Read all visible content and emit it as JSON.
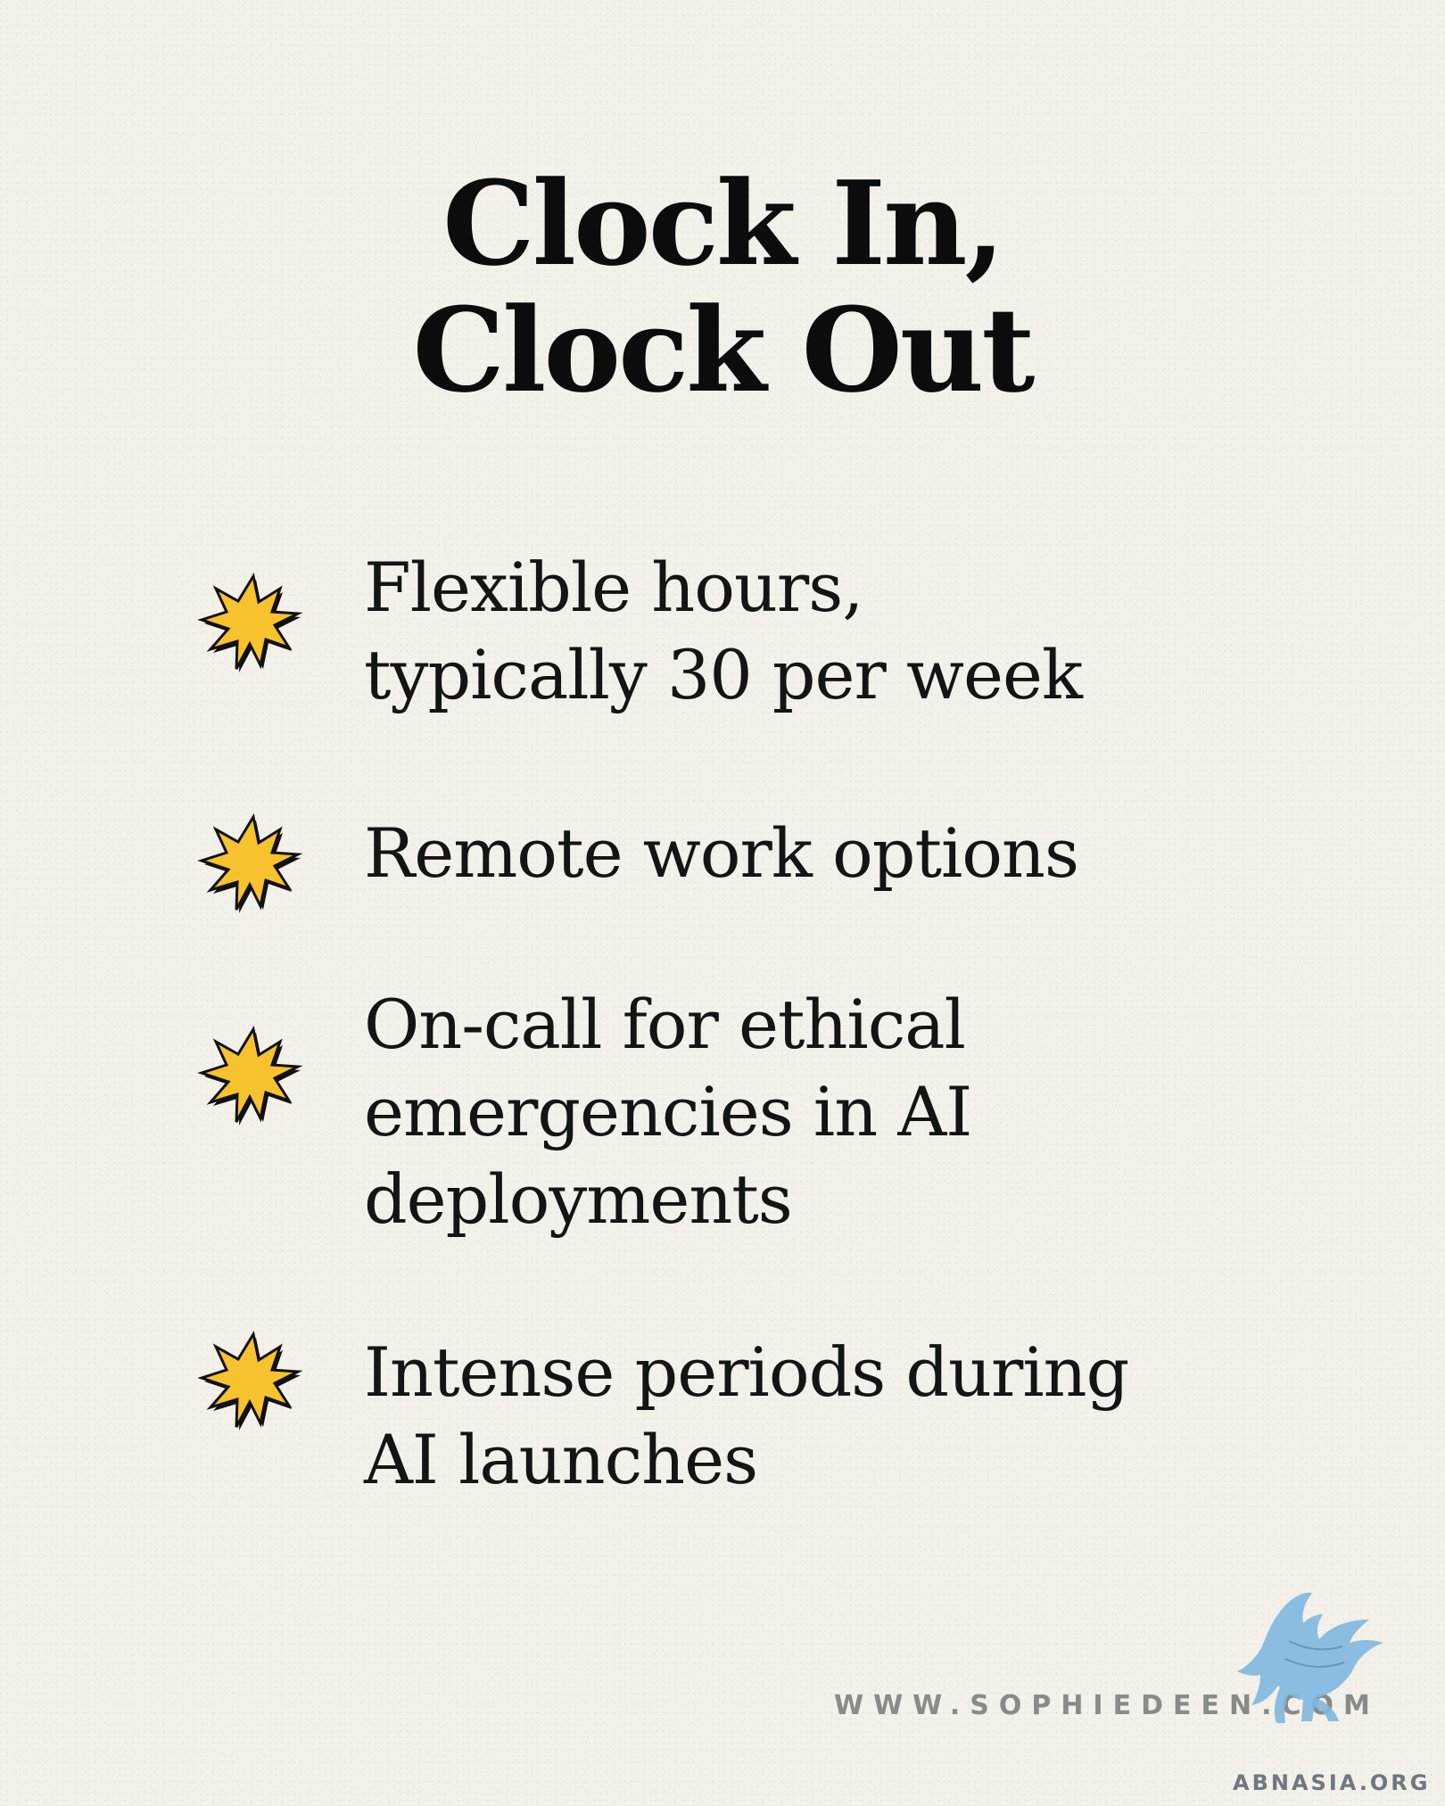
{
  "title": {
    "line1": "Clock In,",
    "line2": "Clock Out"
  },
  "items": [
    {
      "icon": "star-burst-icon",
      "text": "Flexible hours,\ntypically 30 per week"
    },
    {
      "icon": "star-burst-icon",
      "text": "Remote work options"
    },
    {
      "icon": "star-burst-icon",
      "text": "On-call for ethical\nemergencies in AI\ndeployments"
    },
    {
      "icon": "star-burst-icon",
      "text": "Intense periods during\nAI launches"
    }
  ],
  "footer": {
    "website": "WWW.SOPHIEDEEN.COM",
    "logo_icon": "griffin-logo-icon",
    "logo_text": "ABNASIA.ORG"
  },
  "colors": {
    "background": "#f3f1ea",
    "star_fill": "#f6c22d",
    "star_outline": "#111111",
    "text": "#111111",
    "website": "#8a8a8a",
    "logo": "#7fb8e0"
  }
}
